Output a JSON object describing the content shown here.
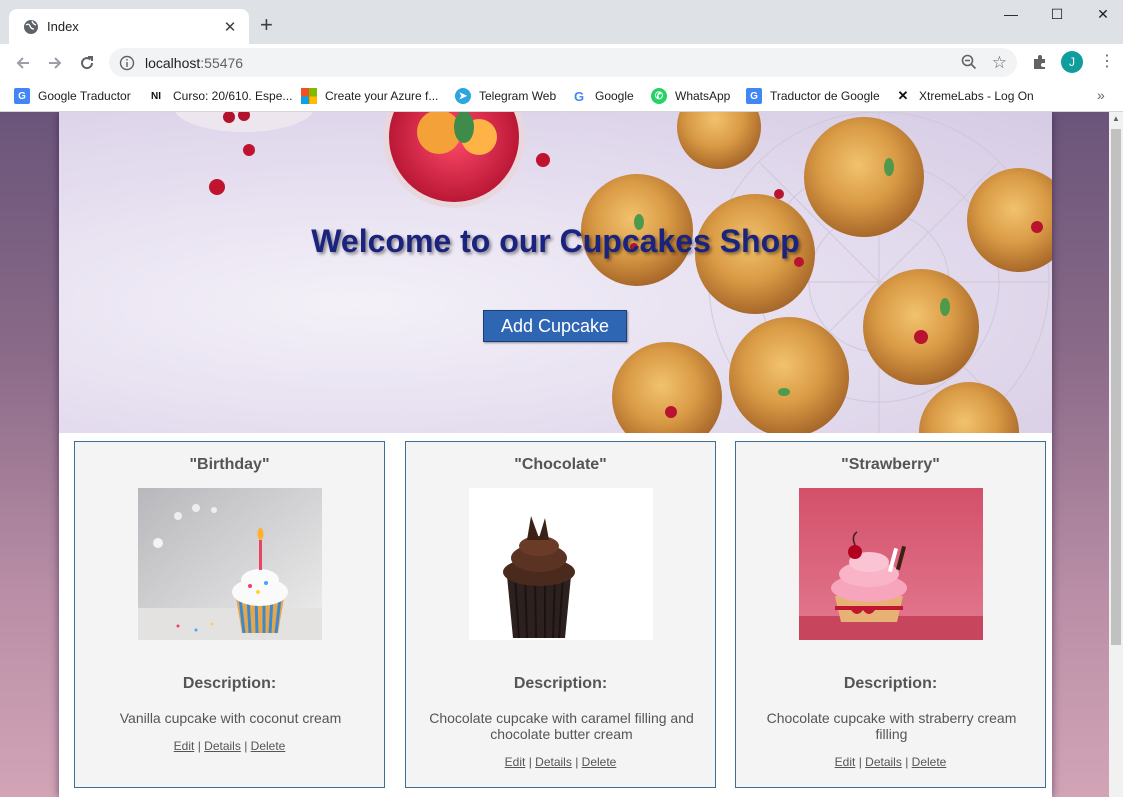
{
  "browser": {
    "tab_title": "Index",
    "tab_close": "✕",
    "new_tab": "+",
    "url_host": "localhost",
    "url_port": ":55476",
    "avatar_letter": "J",
    "window": {
      "minimize": "—",
      "maximize": "☐",
      "close": "✕"
    },
    "bookmarks": [
      {
        "label": "Google Traductor"
      },
      {
        "label": "Curso: 20/610. Espe..."
      },
      {
        "label": "Create your Azure f..."
      },
      {
        "label": "Telegram Web"
      },
      {
        "label": "Google"
      },
      {
        "label": "WhatsApp"
      },
      {
        "label": "Traductor de Google"
      },
      {
        "label": "XtremeLabs - Log On"
      }
    ],
    "bookmarks_more": "»"
  },
  "hero": {
    "title": "Welcome to our Cupcakes Shop",
    "button_label": "Add Cupcake"
  },
  "description_heading": "Description:",
  "actions": {
    "edit": "Edit",
    "details": "Details",
    "delete": "Delete",
    "separator": "|"
  },
  "cupcakes": [
    {
      "name": "\"Birthday\"",
      "description": "Vanilla cupcake with coconut cream"
    },
    {
      "name": "\"Chocolate\"",
      "description": "Chocolate cupcake with caramel filling and chocolate butter cream"
    },
    {
      "name": "\"Strawberry\"",
      "description": "Chocolate cupcake with straberry cream filling"
    }
  ],
  "colors": {
    "hero_title": "#1a237e",
    "button": "#2f66b4",
    "card_border": "#3e6f91",
    "avatar": "#0f9d9d"
  }
}
